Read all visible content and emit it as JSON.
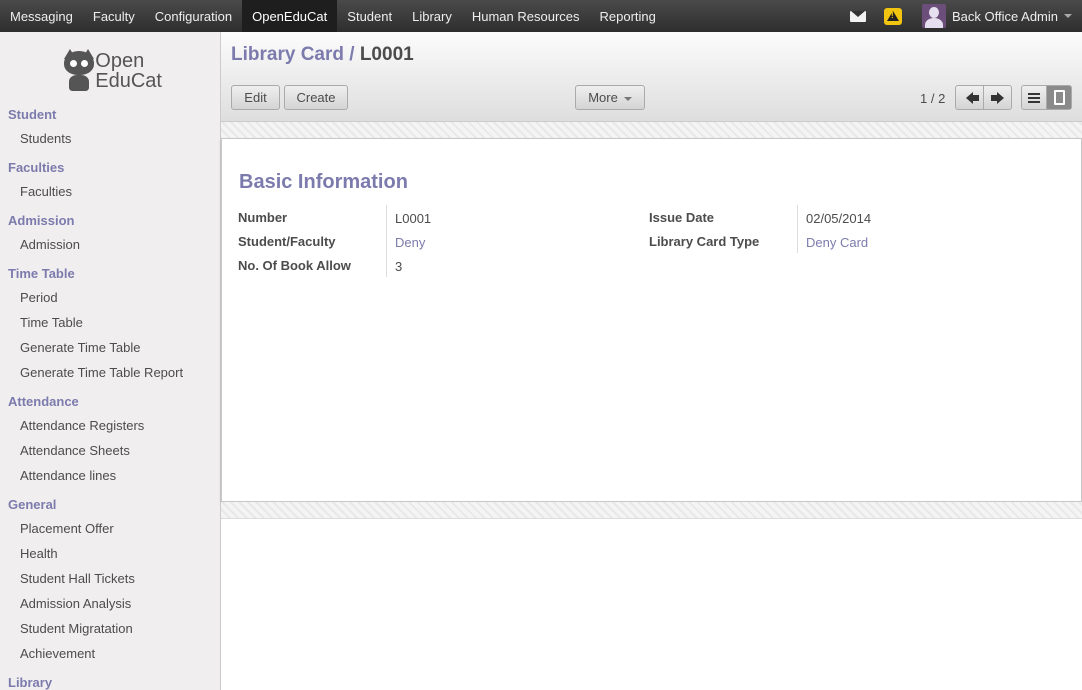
{
  "topmenu": [
    "Messaging",
    "Faculty",
    "Configuration",
    "OpenEduCat",
    "Student",
    "Library",
    "Human Resources",
    "Reporting"
  ],
  "active_menu": "OpenEduCat",
  "user": {
    "name": "Back Office Admin"
  },
  "logo": {
    "line1": "Open",
    "line2": "EduCat"
  },
  "sidebar": {
    "student": {
      "title": "Student",
      "items": [
        "Students"
      ]
    },
    "faculties": {
      "title": "Faculties",
      "items": [
        "Faculties"
      ]
    },
    "admission": {
      "title": "Admission",
      "items": [
        "Admission"
      ]
    },
    "timetable": {
      "title": "Time Table",
      "items": [
        "Period",
        "Time Table",
        "Generate Time Table",
        "Generate Time Table Report"
      ]
    },
    "attendance": {
      "title": "Attendance",
      "items": [
        "Attendance Registers",
        "Attendance Sheets",
        "Attendance lines"
      ]
    },
    "general": {
      "title": "General",
      "items": [
        "Placement Offer",
        "Health",
        "Student Hall Tickets",
        "Admission Analysis",
        "Student Migratation",
        "Achievement"
      ]
    },
    "library": {
      "title": "Library"
    }
  },
  "breadcrumb": {
    "parent": "Library Card",
    "separator": "/",
    "current": "L0001"
  },
  "buttons": {
    "edit": "Edit",
    "create": "Create",
    "more": "More"
  },
  "pager": {
    "text": "1 / 2"
  },
  "form": {
    "section_title": "Basic Information",
    "fields": {
      "number": {
        "label": "Number",
        "value": "L0001"
      },
      "student_faculty": {
        "label": "Student/Faculty",
        "value": "Deny"
      },
      "books_allowed": {
        "label": "No. Of Book Allow",
        "value": "3"
      },
      "issue_date": {
        "label": "Issue Date",
        "value": "02/05/2014"
      },
      "card_type": {
        "label": "Library Card Type",
        "value": "Deny Card"
      }
    }
  },
  "colors": {
    "accent": "#7c7bad",
    "topbar": "#383838"
  }
}
